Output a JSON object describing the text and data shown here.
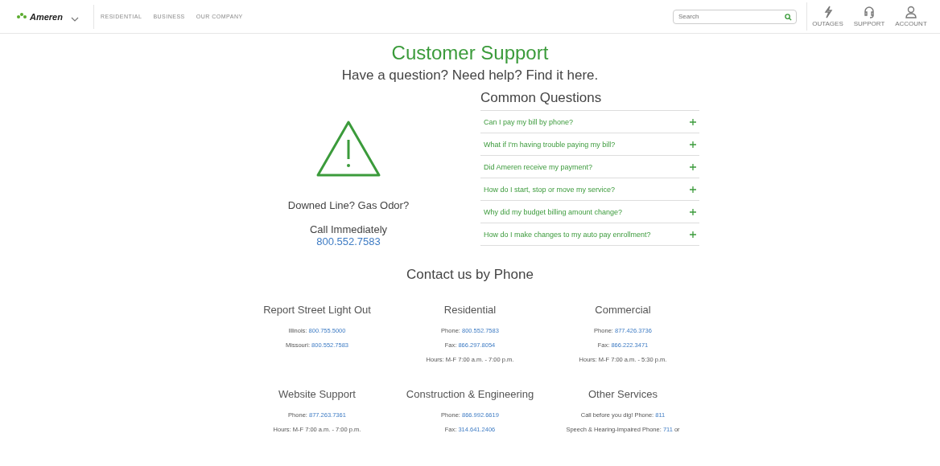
{
  "header": {
    "logo": "Ameren",
    "nav": [
      "RESIDENTIAL",
      "BUSINESS",
      "OUR COMPANY"
    ],
    "search": {
      "placeholder": "Search"
    },
    "actions": [
      {
        "kind": "outages",
        "label": "OUTAGES"
      },
      {
        "kind": "support",
        "label": "SUPPORT"
      },
      {
        "kind": "account",
        "label": "ACCOUNT"
      }
    ]
  },
  "title": "Customer Support",
  "subtitle": "Have a question? Need help? Find it here.",
  "emergency": {
    "heading": "Downed Line? Gas Odor?",
    "call": "Call Immediately",
    "phone": "800.552.7583"
  },
  "faq": {
    "title": "Common Questions",
    "items": [
      {
        "question": "Can I pay my bill by phone?",
        "expanded": false
      },
      {
        "question": "What if I'm having trouble paying my bill?",
        "expanded": false
      },
      {
        "question": "Did Ameren receive my payment?",
        "expanded": false
      },
      {
        "question": "How do I start, stop or move my service?",
        "expanded": false
      },
      {
        "question": "Why did my budget billing amount change?",
        "expanded": false
      },
      {
        "question": "How do I make changes to my auto pay enrollment?",
        "expanded": false
      }
    ]
  },
  "contact": {
    "title": "Contact us by Phone",
    "groups": [
      {
        "title": "Report Street Light Out",
        "lines": [
          {
            "label": "Illinois:",
            "link": "800.755.5000"
          },
          {
            "label": "Missouri:",
            "link": "800.552.7583"
          }
        ]
      },
      {
        "title": "Residential",
        "lines": [
          {
            "label": "Phone:",
            "link": "800.552.7583"
          },
          {
            "label": "Fax:",
            "link": "866.297.8054"
          },
          {
            "label": "Hours: M-F 7:00 a.m. - 7:00 p.m."
          }
        ]
      },
      {
        "title": "Commercial",
        "lines": [
          {
            "label": "Phone:",
            "link": "877.426.3736"
          },
          {
            "label": "Fax:",
            "link": "866.222.3471"
          },
          {
            "label": "Hours: M-F 7:00 a.m. - 5:30 p.m."
          }
        ]
      },
      {
        "title": "Website Support",
        "lines": [
          {
            "label": "Phone:",
            "link": "877.263.7361"
          },
          {
            "label": "Hours: M-F 7:00 a.m. - 7:00 p.m."
          }
        ]
      },
      {
        "title": "Construction & Engineering",
        "lines": [
          {
            "label": "Phone:",
            "link": "866.992.6619"
          },
          {
            "label": "Fax:",
            "link": "314.641.2406"
          }
        ]
      },
      {
        "title": "Other Services",
        "lines": [
          {
            "label": "Call before you dig! Phone:",
            "link": "811"
          },
          {
            "label": "Speech & Hearing-Impaired Phone:",
            "link": "711",
            "suffix": "or"
          }
        ]
      }
    ]
  }
}
